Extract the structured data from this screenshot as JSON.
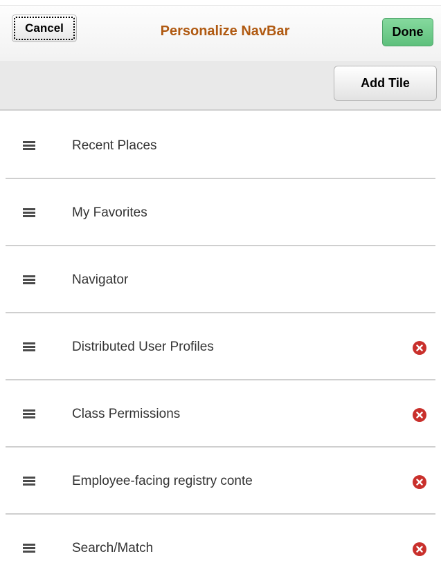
{
  "header": {
    "cancel_label": "Cancel",
    "title": "Personalize NavBar",
    "done_label": "Done"
  },
  "toolbar": {
    "add_tile_label": "Add Tile"
  },
  "tiles": [
    {
      "label": "Recent Places",
      "removable": false
    },
    {
      "label": "My Favorites",
      "removable": false
    },
    {
      "label": "Navigator",
      "removable": false
    },
    {
      "label": "Distributed User Profiles",
      "removable": true
    },
    {
      "label": "Class Permissions",
      "removable": true
    },
    {
      "label": "Employee-facing registry conte",
      "removable": true
    },
    {
      "label": "Search/Match",
      "removable": true
    }
  ],
  "icons": {
    "drag_handle": "drag-handle-icon",
    "delete": "delete-icon"
  },
  "colors": {
    "title": "#b05a12",
    "done_button": "#6cc987",
    "delete_icon": "#c9302c"
  }
}
